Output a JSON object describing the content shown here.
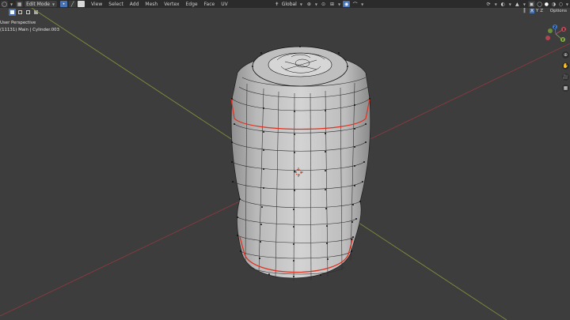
{
  "header": {
    "mode": "Edit Mode",
    "menu": [
      "View",
      "Select",
      "Add",
      "Mesh",
      "Vertex",
      "Edge",
      "Face",
      "UV"
    ],
    "transform_orientation": "Global",
    "xyz": [
      "X",
      "Y",
      "Z"
    ],
    "options": "Options"
  },
  "viewport": {
    "view_name": "User Perspective",
    "object_info": "(11131) Main | Cylinder.003"
  },
  "gizmo": {
    "x": "X",
    "y": "Y",
    "z": "Z"
  },
  "colors": {
    "header_bg": "#2b2b2b",
    "viewport_bg": "#3d3d3d",
    "active_blue": "#4772b3",
    "x_axis": "#d0485a",
    "y_axis": "#8ab04a",
    "z_axis": "#3f7ed6",
    "seam_red": "#e0301e",
    "mesh_fill": "#c8c8c8"
  }
}
